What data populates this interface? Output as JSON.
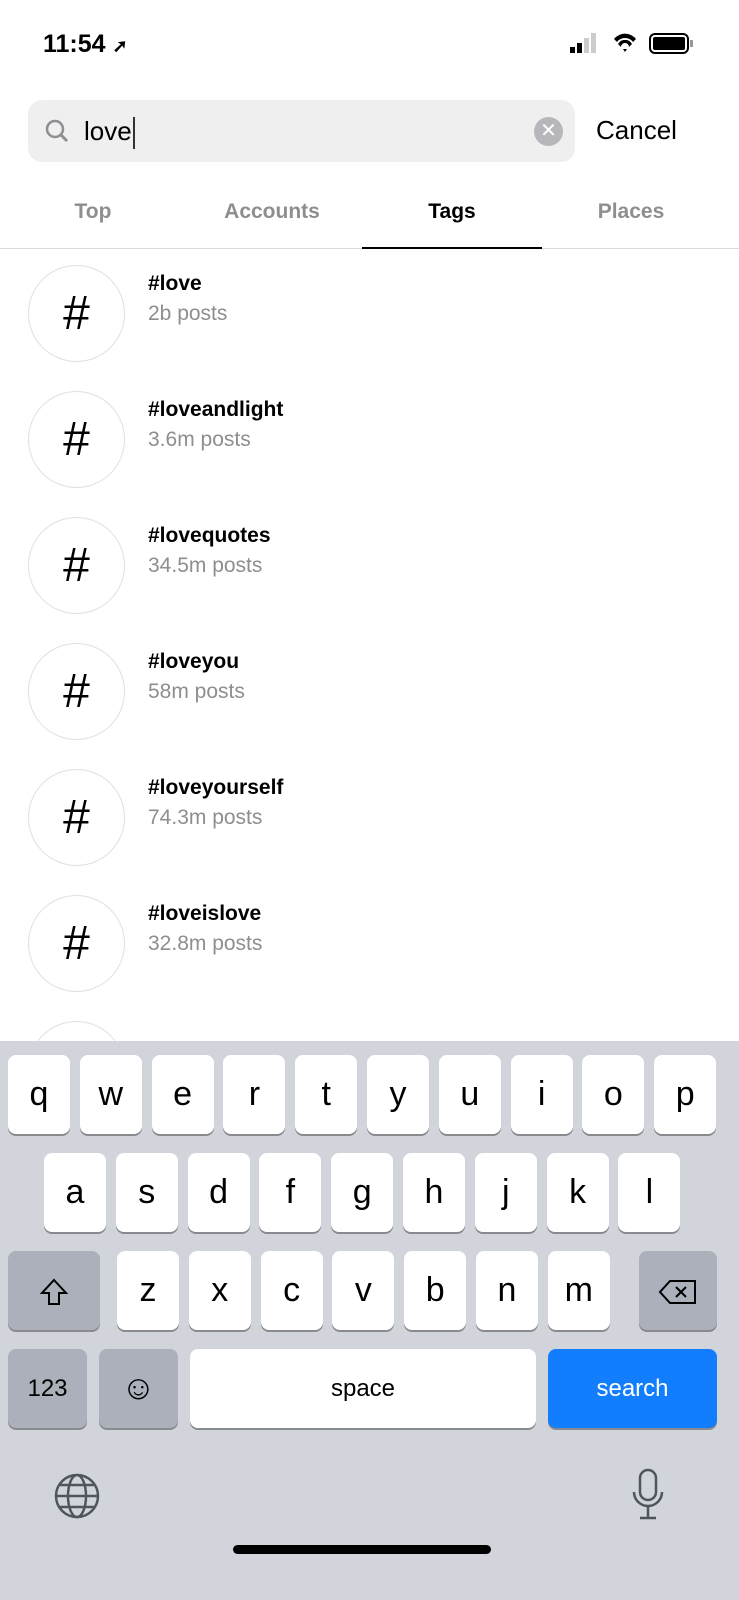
{
  "status_bar": {
    "time": "11:54"
  },
  "search": {
    "value": "love",
    "cancel_label": "Cancel"
  },
  "tabs": [
    {
      "label": "Top"
    },
    {
      "label": "Accounts"
    },
    {
      "label": "Tags"
    },
    {
      "label": "Places"
    }
  ],
  "active_tab": "Tags",
  "results": [
    {
      "tag": "#love",
      "posts": "2b posts"
    },
    {
      "tag": "#loveandlight",
      "posts": "3.6m posts"
    },
    {
      "tag": "#lovequotes",
      "posts": "34.5m posts"
    },
    {
      "tag": "#loveyou",
      "posts": "58m posts"
    },
    {
      "tag": "#loveyourself",
      "posts": "74.3m posts"
    },
    {
      "tag": "#loveislove",
      "posts": "32.8m posts"
    }
  ],
  "hash_symbol": "#",
  "keyboard": {
    "row1": [
      "q",
      "w",
      "e",
      "r",
      "t",
      "y",
      "u",
      "i",
      "o",
      "p"
    ],
    "row2": [
      "a",
      "s",
      "d",
      "f",
      "g",
      "h",
      "j",
      "k",
      "l"
    ],
    "row3": [
      "z",
      "x",
      "c",
      "v",
      "b",
      "n",
      "m"
    ],
    "numbers_label": "123",
    "space_label": "space",
    "search_label": "search"
  },
  "colors": {
    "accent": "#127efe",
    "keyboard_bg": "#d1d4db"
  }
}
